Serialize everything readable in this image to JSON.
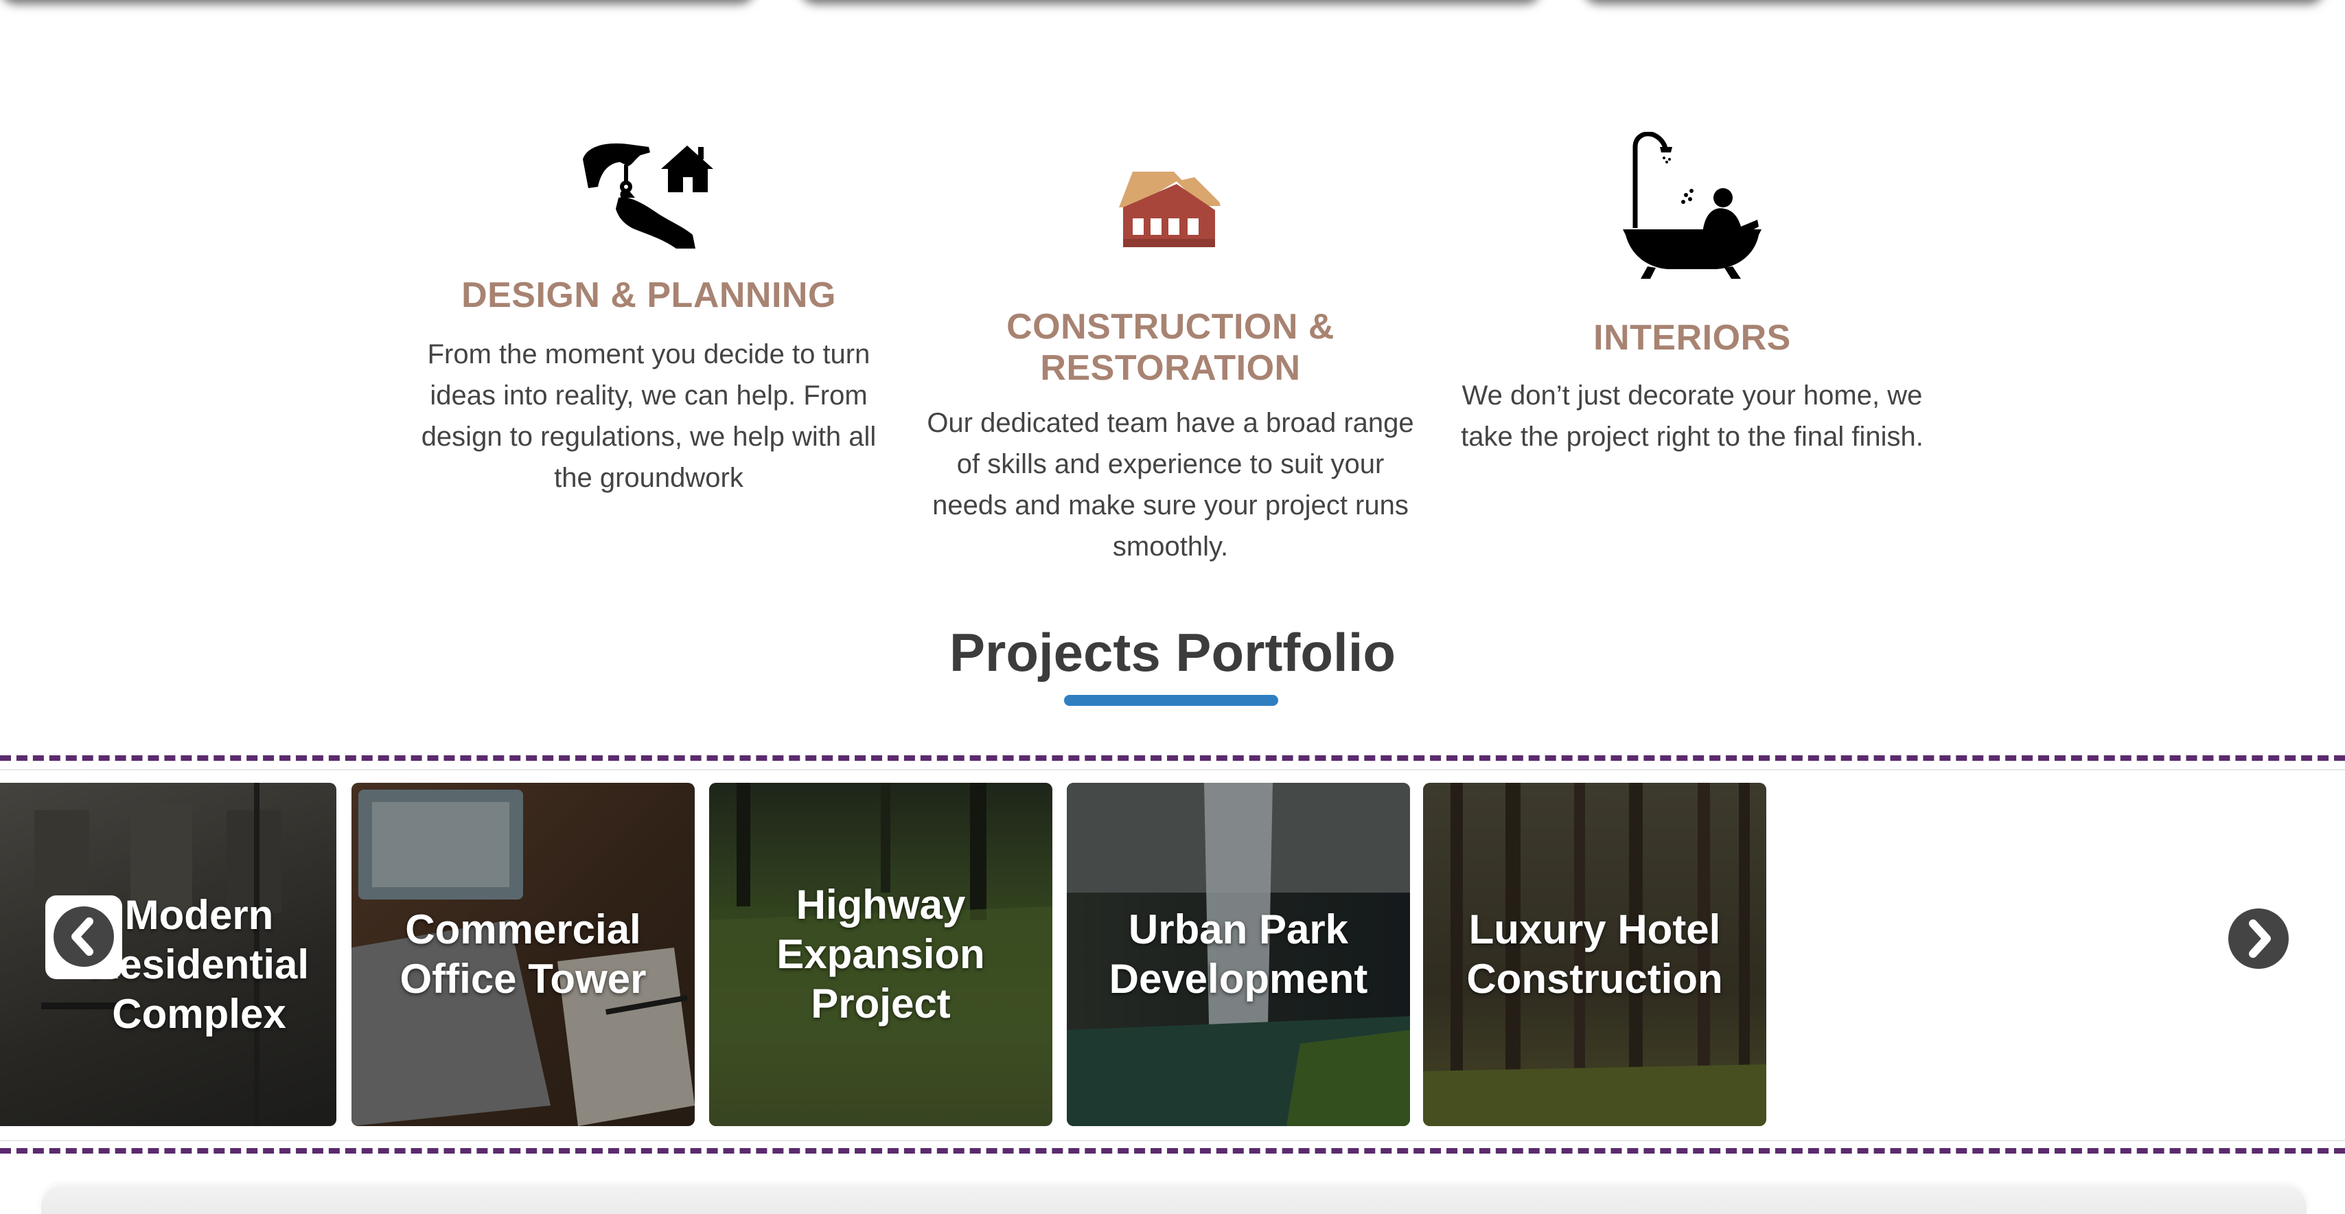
{
  "services": [
    {
      "icon": "key-handover-house-icon",
      "title": "DESIGN & PLANNING",
      "description": "From the moment you decide to turn ideas into reality, we can help. From design to regulations, we help with all the groundwork"
    },
    {
      "icon": "house-icon",
      "title": "CONSTRUCTION & RESTORATION",
      "description": "Our dedicated team have a broad range of skills and experience to suit your needs and make sure your project runs smoothly."
    },
    {
      "icon": "bathtub-icon",
      "title": "INTERIORS",
      "description": "We don’t just decorate your home, we take the project right to the final finish."
    }
  ],
  "portfolio": {
    "title": "Projects Portfolio",
    "projects": [
      {
        "label": "Modern Residential Complex",
        "tone": "#4a4a44"
      },
      {
        "label": "Commercial Office Tower",
        "tone": "#5a4536"
      },
      {
        "label": "Highway Expansion Project",
        "tone": "#4f5e3a"
      },
      {
        "label": "Urban Park Development",
        "tone": "#3e4c46"
      },
      {
        "label": "Luxury Hotel Construction",
        "tone": "#4a4430"
      }
    ]
  },
  "colors": {
    "service_title": "#a88372",
    "accent_underline": "#2f7fc0",
    "dashed_border": "#5b2b6e"
  }
}
